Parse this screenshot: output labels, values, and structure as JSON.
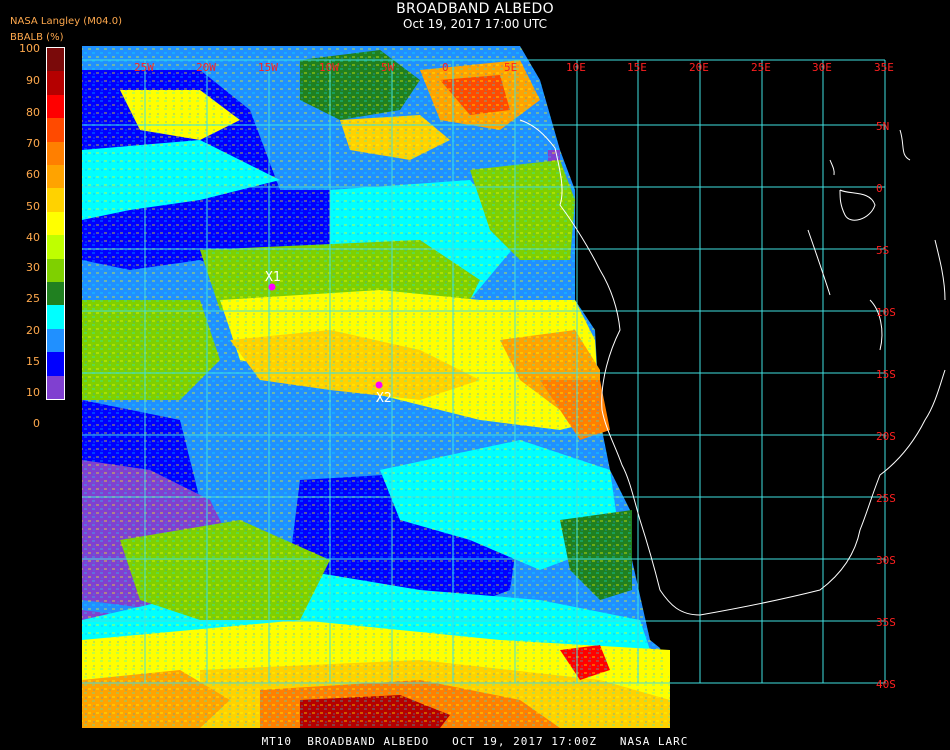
{
  "header": {
    "title": "BROADBAND ALBEDO",
    "subtitle": "Oct 19, 2017 17:00 UTC",
    "provider": "NASA Langley (M04.0)"
  },
  "colorbar": {
    "title": "BBALB (%)",
    "labels": [
      "100",
      "90",
      "80",
      "70",
      "60",
      "50",
      "40",
      "30",
      "25",
      "20",
      "15",
      "10",
      "0"
    ],
    "colors": [
      "#7a0a0a",
      "#b50000",
      "#ff0000",
      "#ff4a00",
      "#ff7f00",
      "#ffa300",
      "#ffd200",
      "#ffff00",
      "#bfff00",
      "#7fd000",
      "#208020",
      "#00ffff",
      "#2090ff",
      "#0000ff",
      "#8040d0"
    ]
  },
  "map": {
    "lon_labels": [
      "25W",
      "20W",
      "15W",
      "10W",
      "5W",
      "0",
      "5E",
      "10E",
      "15E",
      "20E",
      "25E",
      "30E",
      "35E"
    ],
    "lat_labels": [
      "5N",
      "0",
      "5S",
      "10S",
      "15S",
      "20S",
      "25S",
      "30S",
      "35S",
      "40S"
    ],
    "grid_color": "#40e0e0",
    "label_color": "#ff2020",
    "markers": [
      {
        "label": "X1",
        "color": "#ff00ff"
      },
      {
        "label": "X2",
        "color": "#ff00ff"
      }
    ]
  },
  "footer": {
    "text": "MT10  BROADBAND ALBEDO   OCT 19, 2017 17:00Z   NASA LARC"
  }
}
